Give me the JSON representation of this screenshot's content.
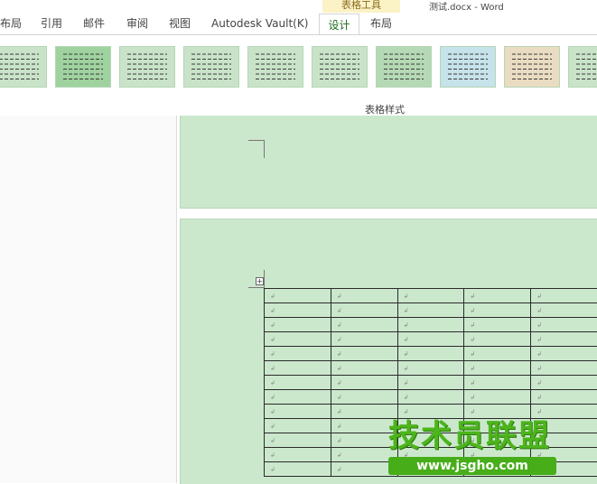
{
  "context_tab_group": "表格工具",
  "document_title": "测试.docx - Word",
  "tabs": [
    {
      "label": "布局"
    },
    {
      "label": "引用"
    },
    {
      "label": "邮件"
    },
    {
      "label": "审阅"
    },
    {
      "label": "视图"
    },
    {
      "label": "Autodesk Vault(K)"
    },
    {
      "label": "设计"
    },
    {
      "label": "布局"
    }
  ],
  "active_tab": "设计",
  "gallery": {
    "group_label": "表格样式",
    "style_count": 10
  },
  "table": {
    "visible_columns": 5,
    "visible_rows": 13,
    "cell_mark": "↲"
  },
  "watermark": {
    "line1": "技术员联盟",
    "line2": "www.jsgho.com"
  },
  "colors": {
    "page_background": "#cbe8cd",
    "active_tab_text": "#1e6e1e",
    "context_group_bg": "#fbf2c6"
  }
}
